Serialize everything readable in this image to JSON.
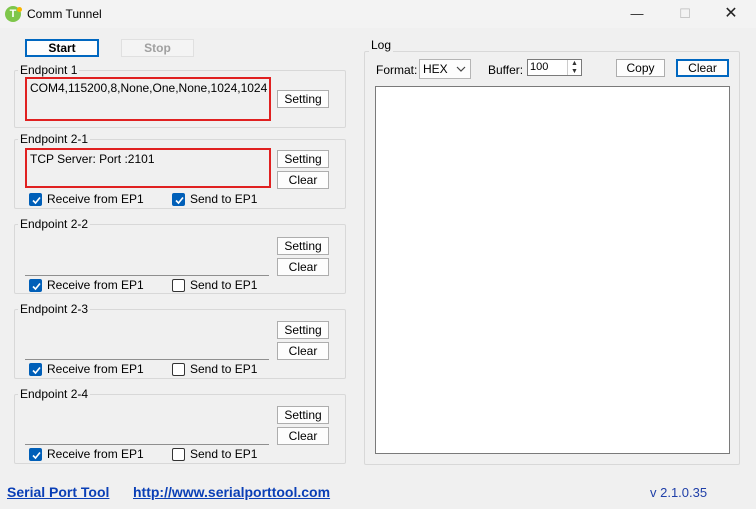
{
  "window": {
    "title": "Comm Tunnel",
    "icon_letter": "T",
    "minimize_glyph": "—",
    "maximize_glyph": "☐",
    "close_glyph": "✕"
  },
  "toolbar": {
    "start_label": "Start",
    "stop_label": "Stop"
  },
  "endpoints": [
    {
      "label": "Endpoint 1",
      "value": "COM4,115200,8,None,One,None,1024,1024",
      "setting_label": "Setting"
    },
    {
      "label": "Endpoint 2-1",
      "value": "TCP Server: Port :2101",
      "setting_label": "Setting",
      "clear_label": "Clear",
      "receive_label": "Receive from EP1",
      "receive_checked": true,
      "send_label": "Send to EP1",
      "send_checked": true
    },
    {
      "label": "Endpoint 2-2",
      "value": "",
      "setting_label": "Setting",
      "clear_label": "Clear",
      "receive_label": "Receive from EP1",
      "receive_checked": true,
      "send_label": "Send to EP1",
      "send_checked": false
    },
    {
      "label": "Endpoint 2-3",
      "value": "",
      "setting_label": "Setting",
      "clear_label": "Clear",
      "receive_label": "Receive from EP1",
      "receive_checked": true,
      "send_label": "Send to EP1",
      "send_checked": false
    },
    {
      "label": "Endpoint 2-4",
      "value": "",
      "setting_label": "Setting",
      "clear_label": "Clear",
      "receive_label": "Receive from EP1",
      "receive_checked": true,
      "send_label": "Send to EP1",
      "send_checked": false
    }
  ],
  "log": {
    "label": "Log",
    "format_label": "Format:",
    "format_value": "HEX",
    "buffer_label": "Buffer:",
    "buffer_value": "100",
    "copy_label": "Copy",
    "clear_label": "Clear"
  },
  "footer": {
    "tool_link": "Serial Port Tool",
    "url_link": "http://www.serialporttool.com",
    "version": "v 2.1.0.35"
  },
  "colors": {
    "accent": "#005fb8",
    "highlight_border": "#e02020",
    "link": "#0a3fb6"
  }
}
